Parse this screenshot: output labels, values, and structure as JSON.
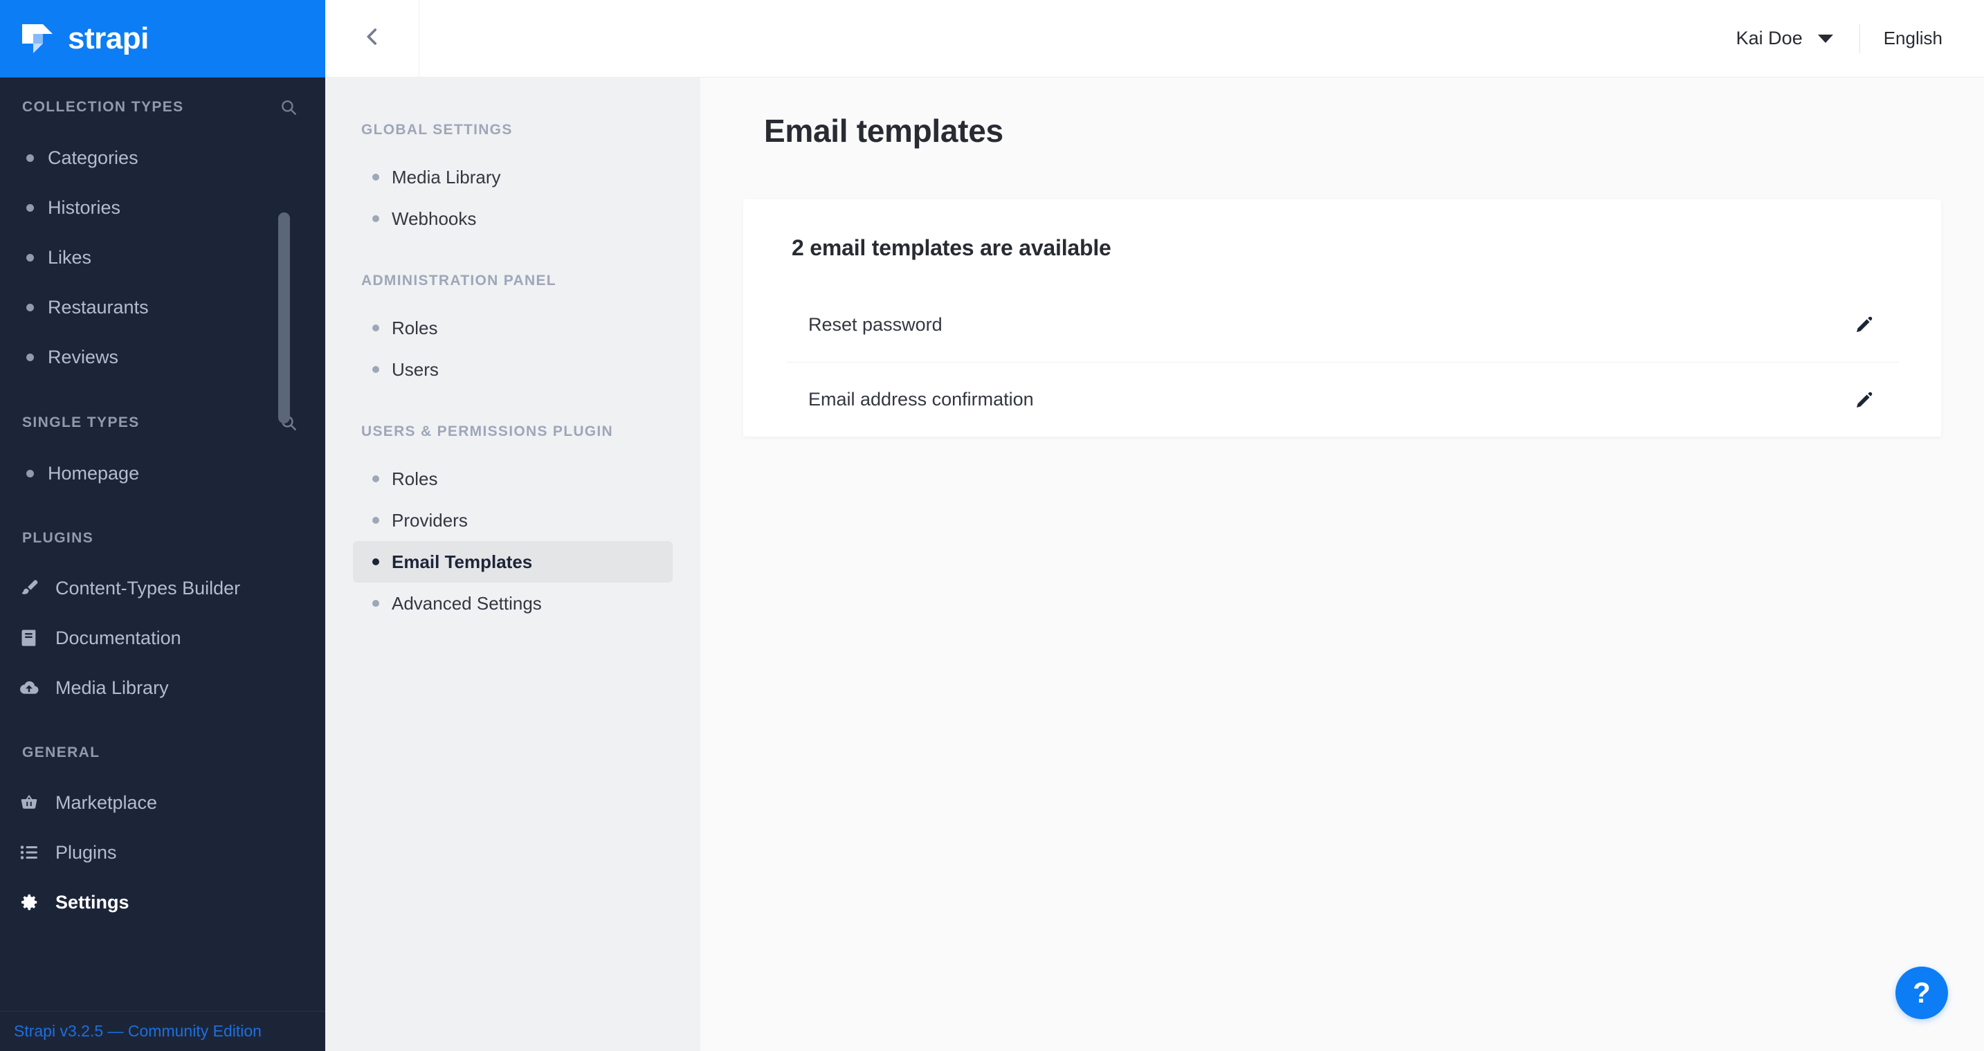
{
  "brand": {
    "name": "strapi",
    "logo_icon": "strapi-logo-icon",
    "color": "#0c7df5"
  },
  "sidebar": {
    "sections": [
      {
        "title": "COLLECTION TYPES",
        "has_search": true,
        "search_icon": "search-icon",
        "items": [
          {
            "label": "Categories"
          },
          {
            "label": "Histories"
          },
          {
            "label": "Likes"
          },
          {
            "label": "Restaurants"
          },
          {
            "label": "Reviews"
          }
        ]
      },
      {
        "title": "SINGLE TYPES",
        "has_search": true,
        "search_icon": "search-icon",
        "items": [
          {
            "label": "Homepage"
          }
        ]
      },
      {
        "title": "PLUGINS",
        "has_search": false,
        "items": [
          {
            "label": "Content-Types Builder",
            "icon": "paintbrush-icon"
          },
          {
            "label": "Documentation",
            "icon": "book-icon"
          },
          {
            "label": "Media Library",
            "icon": "cloud-upload-icon"
          }
        ]
      },
      {
        "title": "GENERAL",
        "has_search": false,
        "items": [
          {
            "label": "Marketplace",
            "icon": "shopping-basket-icon"
          },
          {
            "label": "Plugins",
            "icon": "list-icon"
          },
          {
            "label": "Settings",
            "icon": "gear-icon",
            "active": true
          }
        ]
      }
    ],
    "footer": {
      "text": "Strapi v3.2.5 — Community Edition",
      "color": "#1c6fe0"
    }
  },
  "topbar": {
    "back_icon": "chevron-left-icon",
    "user": {
      "name": "Kai Doe",
      "caret_icon": "chevron-down-icon"
    },
    "language": "English"
  },
  "settings_nav": {
    "groups": [
      {
        "title": "GLOBAL SETTINGS",
        "items": [
          {
            "label": "Media Library"
          },
          {
            "label": "Webhooks"
          }
        ]
      },
      {
        "title": "ADMINISTRATION PANEL",
        "items": [
          {
            "label": "Roles"
          },
          {
            "label": "Users"
          }
        ]
      },
      {
        "title": "USERS & PERMISSIONS PLUGIN",
        "items": [
          {
            "label": "Roles"
          },
          {
            "label": "Providers"
          },
          {
            "label": "Email Templates",
            "active": true
          },
          {
            "label": "Advanced Settings"
          }
        ]
      }
    ]
  },
  "main": {
    "page_title": "Email templates",
    "card": {
      "title": "2 email templates are available",
      "rows": [
        {
          "name": "Reset password",
          "edit_icon": "pencil-icon"
        },
        {
          "name": "Email address confirmation",
          "edit_icon": "pencil-icon"
        }
      ]
    },
    "help_button": {
      "label": "?",
      "icon": "question-mark-icon",
      "color": "#0c7df5"
    }
  }
}
